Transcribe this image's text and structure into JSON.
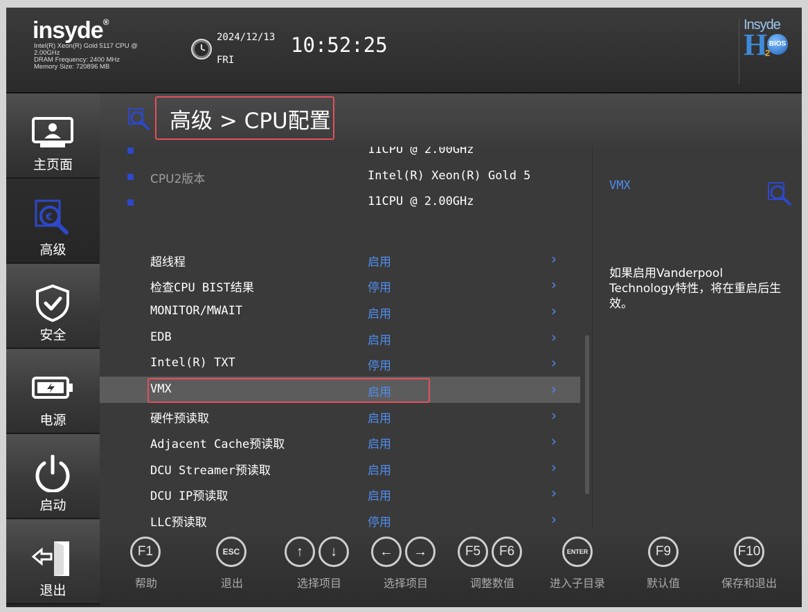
{
  "header": {
    "logo": "insyde",
    "sysinfo": [
      "Intel(R) Xeon(R) Gold 5117 CPU @",
      "2.00GHz",
      "DRAM Frequency: 2400 MHz",
      "Memory Size: 720896 MB"
    ],
    "date": "2024/12/13",
    "weekday": "FRI",
    "time": "10:52:25",
    "brand": {
      "line1": "Insyde",
      "h": "H",
      "two": "2",
      "bios": "BIOS"
    }
  },
  "sidebar": {
    "items": [
      {
        "label": "主页面",
        "icon": "monitor-icon"
      },
      {
        "label": "高级",
        "icon": "advanced-icon",
        "active": true
      },
      {
        "label": "安全",
        "icon": "shield-icon"
      },
      {
        "label": "电源",
        "icon": "battery-icon"
      },
      {
        "label": "启动",
        "icon": "power-icon"
      },
      {
        "label": "退出",
        "icon": "exit-icon"
      }
    ]
  },
  "main": {
    "breadcrumb": "高级 > CPU配置",
    "rows": [
      {
        "label": "",
        "value": "11CPU @ 2.00GHz",
        "bullet": true
      },
      {
        "label": "CPU2版本",
        "value": "Intel(R) Xeon(R) Gold 5",
        "bullet": true,
        "dim": true
      },
      {
        "label": "",
        "value": "11CPU @ 2.00GHz",
        "bullet": true
      },
      {
        "label": "超线程",
        "value": "启用",
        "arrow": "›"
      },
      {
        "label": "检查CPU BIST结果",
        "value": "停用",
        "arrow": "›"
      },
      {
        "label": "MONITOR/MWAIT",
        "value": "启用",
        "arrow": "›"
      },
      {
        "label": "EDB",
        "value": "启用",
        "arrow": "›"
      },
      {
        "label": "Intel(R) TXT",
        "value": "停用",
        "arrow": "›"
      },
      {
        "label": "VMX",
        "value": "启用",
        "arrow": "›",
        "selected": true
      },
      {
        "label": "硬件预读取",
        "value": "启用",
        "arrow": "›"
      },
      {
        "label": "Adjacent Cache预读取",
        "value": "启用",
        "arrow": "›"
      },
      {
        "label": "DCU Streamer预读取",
        "value": "启用",
        "arrow": "›"
      },
      {
        "label": "DCU IP预读取",
        "value": "启用",
        "arrow": "›"
      },
      {
        "label": "LLC预读取",
        "value": "停用",
        "arrow": "›"
      }
    ]
  },
  "help": {
    "title": "VMX",
    "text": "如果启用Vanderpool Technology特性，将在重启后生效。"
  },
  "footer": {
    "keys": [
      {
        "keys": [
          "F1"
        ],
        "label": "帮助"
      },
      {
        "keys": [
          "ESC"
        ],
        "label": "退出"
      },
      {
        "keys": [
          "↑",
          "↓"
        ],
        "label": "选择项目"
      },
      {
        "keys": [
          "←",
          "→"
        ],
        "label": "选择项目"
      },
      {
        "keys": [
          "F5",
          "F6"
        ],
        "label": "调整数值"
      },
      {
        "keys": [
          "ENTER"
        ],
        "label": "进入子目录"
      },
      {
        "keys": [
          "F9"
        ],
        "label": "默认值"
      },
      {
        "keys": [
          "F10"
        ],
        "label": "保存和退出"
      }
    ]
  },
  "colors": {
    "accent_blue": "#4f8df0",
    "highlight_red": "#e3505e",
    "bullet_blue": "#2d48c8"
  }
}
